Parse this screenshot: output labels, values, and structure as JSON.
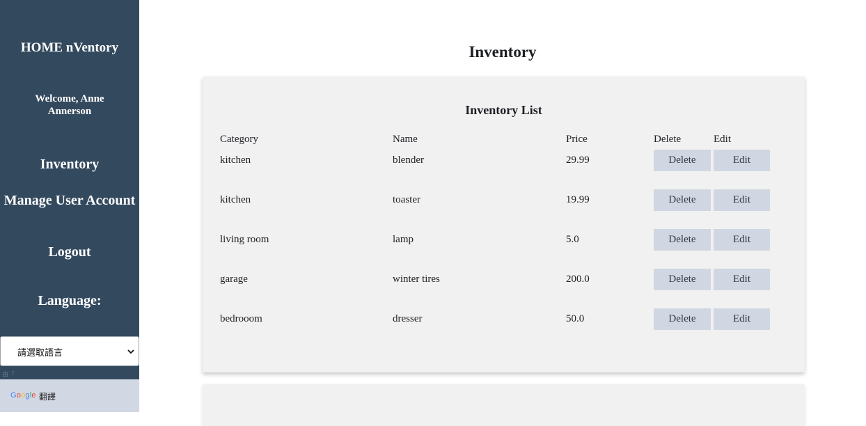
{
  "sidebar": {
    "brand": "HOME nVentory",
    "welcome": "Welcome, Anne Annerson",
    "nav": {
      "inventory": "Inventory",
      "manage_account": "Manage User Account",
      "logout": "Logout"
    },
    "language_label": "Language:",
    "language_select": {
      "value": "請選取語言",
      "chevron_icon": "chevron-down-icon"
    },
    "powered_by": "由「",
    "google_translate": {
      "logo": "Google",
      "label": "翻譯"
    }
  },
  "main": {
    "title": "Inventory",
    "list_title": "Inventory List",
    "columns": {
      "category": "Category",
      "name": "Name",
      "price": "Price",
      "delete": "Delete",
      "edit": "Edit"
    },
    "rows": [
      {
        "category": "kitchen",
        "name": "blender",
        "price": "29.99",
        "delete_label": "Delete",
        "edit_label": "Edit"
      },
      {
        "category": "kitchen",
        "name": "toaster",
        "price": "19.99",
        "delete_label": "Delete",
        "edit_label": "Edit"
      },
      {
        "category": "living room",
        "name": "lamp",
        "price": "5.0",
        "delete_label": "Delete",
        "edit_label": "Edit"
      },
      {
        "category": "garage",
        "name": "winter tires",
        "price": "200.0",
        "delete_label": "Delete",
        "edit_label": "Edit"
      },
      {
        "category": "bedrooom",
        "name": "dresser",
        "price": "50.0",
        "delete_label": "Delete",
        "edit_label": "Edit"
      }
    ]
  },
  "colors": {
    "sidebar_bg": "#33495e",
    "button_bg": "#d0d7e3",
    "card_bg": "#f1f1f1",
    "google_bar_bg": "#d1d8e4"
  }
}
